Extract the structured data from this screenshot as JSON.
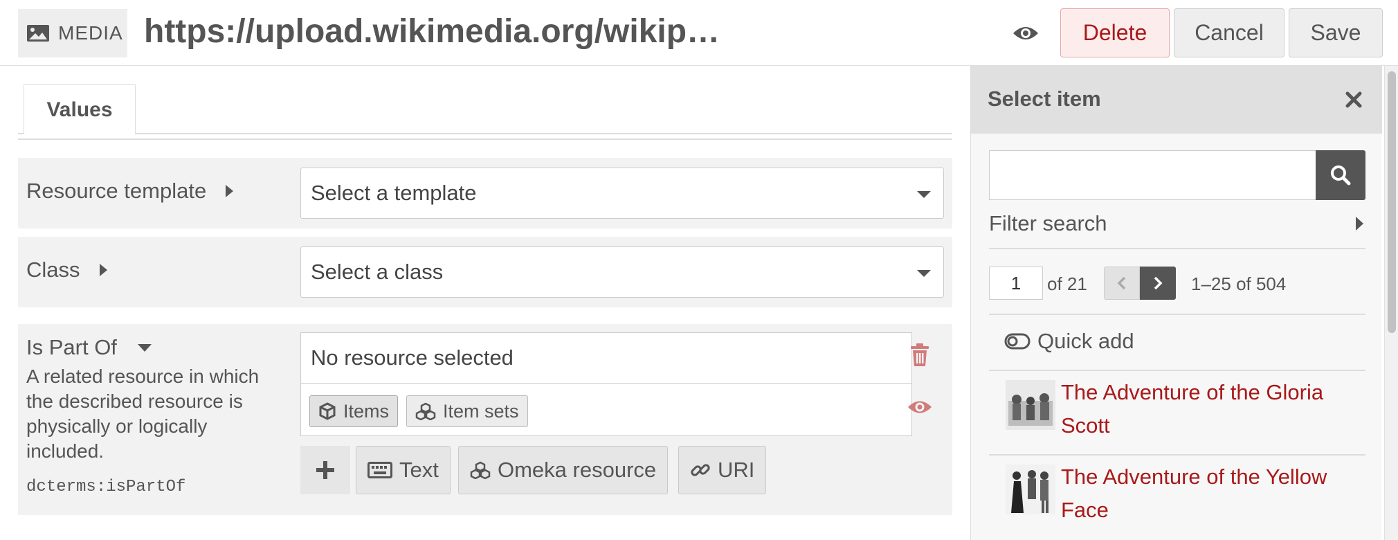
{
  "header": {
    "badge_label": "MEDIA",
    "title": "https://upload.wikimedia.org/wikip…",
    "delete_label": "Delete",
    "cancel_label": "Cancel",
    "save_label": "Save"
  },
  "tabs": [
    {
      "label": "Values"
    }
  ],
  "fields": {
    "resource_template": {
      "label": "Resource template",
      "value": "Select a template"
    },
    "class": {
      "label": "Class",
      "value": "Select a class"
    },
    "is_part_of": {
      "label": "Is Part Of",
      "description": "A related resource in which the described resource is physically or logically included.",
      "term": "dcterms:isPartOf",
      "empty_text": "No resource selected",
      "chips": [
        "Items",
        "Item sets"
      ],
      "add_types": [
        "Text",
        "Omeka resource",
        "URI"
      ]
    }
  },
  "sidebar": {
    "title": "Select item",
    "search_value": "",
    "filter_label": "Filter search",
    "page": "1",
    "page_of": "of 21",
    "range": "1–25 of 504",
    "quick_add": "Quick add",
    "results": [
      {
        "title": "The Adventure of the Gloria Scott"
      },
      {
        "title": "The Adventure of the Yellow Face"
      }
    ]
  },
  "colors": {
    "accent_red": "#a91919",
    "delete_bg": "#fdecec",
    "dark_button": "#555555"
  },
  "icons": [
    "image-icon",
    "eye-icon",
    "cube-icon",
    "cubes-icon",
    "keyboard-icon",
    "link-icon",
    "trash-icon",
    "plus-icon",
    "search-icon",
    "close-icon",
    "toggle-icon"
  ]
}
